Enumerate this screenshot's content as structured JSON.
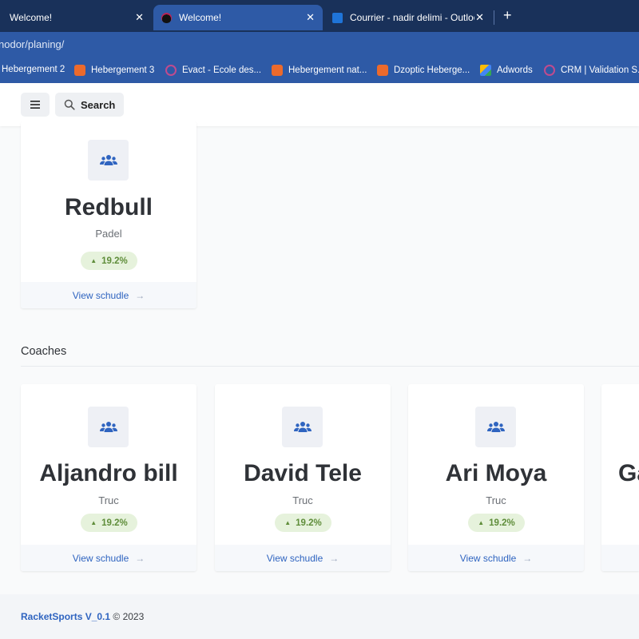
{
  "browser": {
    "tabs": [
      {
        "title": "Welcome!",
        "close": "✕"
      },
      {
        "title": "Welcome!",
        "close": "✕"
      },
      {
        "title": "Courrier - nadir delimi - Outlook",
        "close": "✕"
      }
    ],
    "new_tab": "+",
    "url": "nodor/planing/",
    "bookmarks": [
      {
        "label": "Hebergement 2"
      },
      {
        "label": "Hebergement 3"
      },
      {
        "label": "Evact - Ecole des..."
      },
      {
        "label": "Hebergement nat..."
      },
      {
        "label": "Dzoptic Heberge..."
      },
      {
        "label": "Adwords"
      },
      {
        "label": "CRM | Validation S..."
      }
    ]
  },
  "toolbar": {
    "menu_icon": "≡",
    "search_label": "Search"
  },
  "clubs": [
    {
      "name": "Redbull",
      "sport": "Padel",
      "trend": "19.2%",
      "link": "View schudle"
    }
  ],
  "coaches_section": {
    "title": "Coaches",
    "items": [
      {
        "name": "Aljandro bill",
        "sport": "Truc",
        "trend": "19.2%",
        "link": "View schudle"
      },
      {
        "name": "David Tele",
        "sport": "Truc",
        "trend": "19.2%",
        "link": "View schudle"
      },
      {
        "name": "Ari Moya",
        "sport": "Truc",
        "trend": "19.2%",
        "link": "View schudle"
      },
      {
        "name": "Ga",
        "sport": "",
        "trend": "",
        "link": ""
      }
    ]
  },
  "footer": {
    "brand": "RacketSports V_0.1",
    "copyright": "© 2023"
  },
  "colors": {
    "accent": "#2f64c0",
    "trend_up": "#5f8d3a",
    "chrome": "#2e5aa6"
  }
}
